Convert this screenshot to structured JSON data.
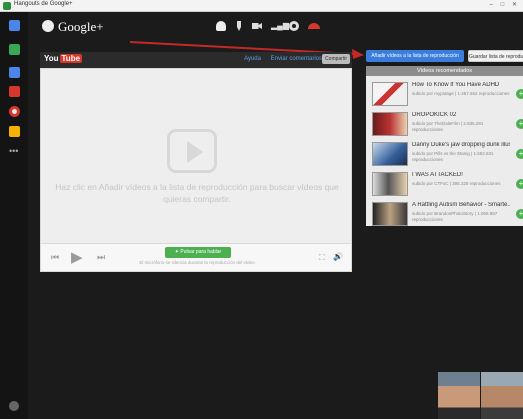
{
  "window": {
    "title": "Hangouts de Google+",
    "controls": "– □ ✕"
  },
  "hangout": {
    "logo_text": "Google+"
  },
  "youtube": {
    "logo_you": "You",
    "logo_tube": "Tube",
    "link_1": "Ayuda",
    "link_2": "Enviar comentarios",
    "share_label": "Compartir"
  },
  "player": {
    "hint": "Haz clic en Añadir vídeos a la lista de reproducción para buscar vídeos que quieras compartir.",
    "follow_button": "✦ Pulsar para hablar",
    "follow_sub": "El micrófono se silencia durante la reproducción del vídeo"
  },
  "playlist": {
    "add_button": "Añadir vídeos a la lista de reproducción",
    "clear_button": "Guardar lista de reproducción",
    "header": "Vídeos recomendados",
    "videos": [
      {
        "title": "How To Know If You Have ADHD",
        "meta": "subido por mypstage | 1.457.552 reproducciones"
      },
      {
        "title": "DROPOKICK 02",
        "meta": "subido por TheDaleFilm | 2.835.291 reproducciones"
      },
      {
        "title": "Danny Duke's jaw dropping dunk illus...",
        "meta": "subido por Pills vs the Stanig | 1.652.631 reproducciones"
      },
      {
        "title": "I WAS ATTACKED!",
        "meta": "subido por CTFxC | 395.328 reproducciones"
      },
      {
        "title": "A Rattling Autism Behavior - Smarte...",
        "meta": "subido por BrandonPhotoStory | 1.068.897 reproducciones"
      }
    ]
  },
  "icons": {
    "rail": [
      "chat-icon",
      "screenshare-icon",
      "capture-icon",
      "youtube-icon",
      "google-effects-icon",
      "slides-icon",
      "more-apps-icon"
    ],
    "controls": [
      "invite-icon",
      "mic-mute-icon",
      "camera-mute-icon",
      "bandwidth-icon",
      "settings-icon",
      "hang-up-icon"
    ]
  },
  "colors": {
    "accent_blue": "#3b7ddd",
    "annotation_red": "#c62828",
    "follow_green": "#4caf50"
  }
}
